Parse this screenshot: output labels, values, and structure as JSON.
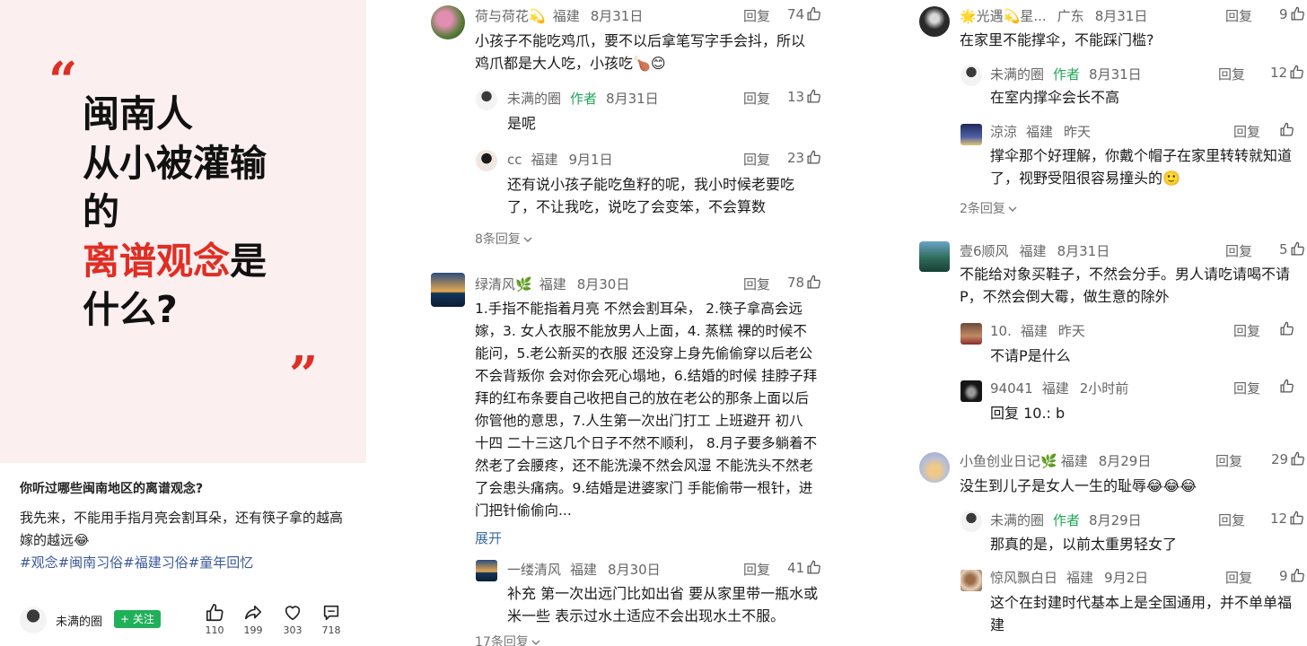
{
  "post": {
    "cover": {
      "open_quote": "“",
      "close_quote": "”",
      "line1": "闽南人",
      "line2": "从小被灌输",
      "line3": "的",
      "line4_red": "离谱观念",
      "line4_rest": "是",
      "line5": "什么?"
    },
    "title": "你听过哪些闽南地区的离谱观念?",
    "body": "我先来，不能用手指月亮会割耳朵，还有筷子拿的越高嫁的越远😂",
    "tags": "#观念#闽南习俗#福建习俗#童年回忆",
    "author": {
      "name": "未满的圈",
      "follow": "+ 关注"
    },
    "stats": {
      "likes": "110",
      "shares": "199",
      "favorites": "303",
      "comments": "718"
    },
    "icons": [
      "thumb-up-icon",
      "share-icon",
      "heart-icon",
      "comment-icon"
    ]
  },
  "comments_col1": [
    {
      "name": "荷与荷花💫",
      "loc": "福建",
      "date": "8月31日",
      "reply": "回复",
      "likes": "74",
      "text": "小孩子不能吃鸡爪，要不以后拿笔写字手会抖，所以鸡爪都是大人吃，小孩吃🍗😊"
    },
    {
      "name": "未满的圈",
      "author": "作者",
      "date": "8月31日",
      "reply": "回复",
      "likes": "13",
      "text": "是呢"
    },
    {
      "name": "cc",
      "loc": "福建",
      "date": "9月1日",
      "reply": "回复",
      "likes": "23",
      "text": "还有说小孩子能吃鱼籽的呢，我小时候老要吃了，不让我吃，说吃了会变笨，不会算数"
    },
    {
      "more": "8条回复"
    },
    {
      "name": "绿清风🌿",
      "loc": "福建",
      "date": "8月30日",
      "reply": "回复",
      "likes": "78",
      "text": "1.手指不能指着月亮 不然会割耳朵， 2.筷子拿高会远嫁，3. 女人衣服不能放男人上面，4. 蒸糕 裸的时候不能问，5.老公新买的衣服 还没穿上身先偷偷穿以后老公不会背叛你 会对你会死心塌地，6.结婚的时候 挂脖子拜拜的红布条要自己收把自己的放在老公的那条上面以后你管他的意思，7.人生第一次出门打工 上班避开 初八 十四 二十三这几个日子不然不顺利， 8.月子要多躺着不然老了会腰疼，还不能洗澡不然会风湿 不能洗头不然老了会患头痛病。9.结婚是进婆家门 手能偷带一根针，进门把针偷偷向...",
      "expand": "展开"
    },
    {
      "name": "一缕清风",
      "loc": "福建",
      "date": "8月30日",
      "reply": "回复",
      "likes": "41",
      "text": "补充 第一次出远门比如出省 要从家里带一瓶水或米一些 表示过水土适应不会出现水土不服。"
    },
    {
      "more": "17条回复"
    }
  ],
  "comments_col2": [
    {
      "name": "🌟光遇💫星...",
      "loc": "广东",
      "date": "8月31日",
      "reply": "回复",
      "likes": "9",
      "text": "在家里不能撑伞，不能踩门槛?"
    },
    {
      "name": "未满的圈",
      "author": "作者",
      "date": "8月31日",
      "reply": "回复",
      "likes": "12",
      "text": "在室内撑伞会长不高"
    },
    {
      "name": "涼涼",
      "loc": "福建",
      "date": "昨天",
      "reply": "回复",
      "likes": "",
      "text": "撑伞那个好理解，你戴个帽子在家里转转就知道了，视野受阻很容易撞头的🙂"
    },
    {
      "more": "2条回复"
    },
    {
      "name": "壹6顺风",
      "loc": "福建",
      "date": "8月31日",
      "reply": "回复",
      "likes": "5",
      "text": "不能给对象买鞋子，不然会分手。男人请吃请喝不请P，不然会倒大霉，做生意的除外"
    },
    {
      "name": "10.",
      "loc": "福建",
      "date": "昨天",
      "reply": "回复",
      "likes": "",
      "text": "不请P是什么"
    },
    {
      "name": "94041",
      "loc": "福建",
      "date": "2小时前",
      "reply": "回复",
      "likes": "",
      "text": "回复 10.: b"
    },
    {
      "name": "小鱼创业日记🌿",
      "loc": "福建",
      "date": "8月29日",
      "reply": "回复",
      "likes": "29",
      "text": "没生到儿子是女人一生的耻辱😂😂😂"
    },
    {
      "name": "未满的圈",
      "author": "作者",
      "date": "8月29日",
      "reply": "回复",
      "likes": "12",
      "text": "那真的是，以前太重男轻女了"
    },
    {
      "name": "惊风飘白日",
      "loc": "福建",
      "date": "9月2日",
      "reply": "回复",
      "likes": "9",
      "text": "这个在封建时代基本上是全国通用，并不单单福建"
    }
  ]
}
